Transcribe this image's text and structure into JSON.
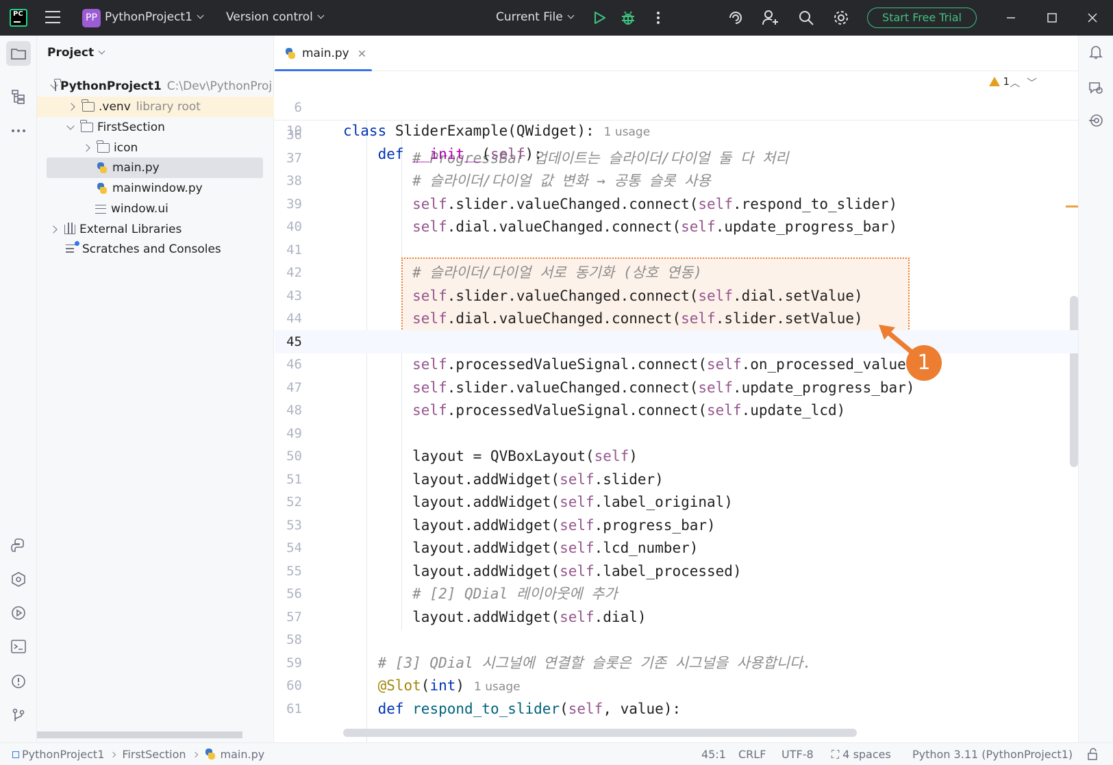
{
  "titlebar": {
    "project_badge": "PP",
    "project_name": "PythonProject1",
    "version_control": "Version control",
    "run_config": "Current File",
    "trial_button": "Start Free Trial",
    "app_logo": "PC"
  },
  "project_panel": {
    "header": "Project",
    "tree": {
      "root_name": "PythonProject1",
      "root_path": "C:\\Dev\\PythonProj",
      "venv_name": ".venv",
      "venv_hint": "library root",
      "folder_first_section": "FirstSection",
      "folder_icon": "icon",
      "file_main": "main.py",
      "file_mainwindow": "mainwindow.py",
      "file_window_ui": "window.ui",
      "external_libraries": "External Libraries",
      "scratches": "Scratches and Consoles"
    }
  },
  "editor": {
    "tab_label": "main.py",
    "warning_count": "1",
    "callout_number": "1",
    "sticky": [
      {
        "ln": "6",
        "code": "class SliderExample(QWidget):",
        "hint": "1 usage"
      },
      {
        "ln": "10",
        "code": "    def __init__(self):"
      }
    ],
    "lines": {
      "l36": {
        "ln": "36",
        "code": ""
      },
      "l37": {
        "ln": "37",
        "code": "        # ProgressBar 업데이트는 슬라이더/다이얼 둘 다 처리"
      },
      "l38": {
        "ln": "38",
        "code": "        # 슬라이더/다이얼 값 변화 → 공통 슬롯 사용"
      },
      "l39": {
        "ln": "39",
        "code": "        self.slider.valueChanged.connect(self.respond_to_slider)"
      },
      "l40": {
        "ln": "40",
        "code": "        self.dial.valueChanged.connect(self.update_progress_bar)"
      },
      "l41": {
        "ln": "41",
        "code": ""
      },
      "l42": {
        "ln": "42",
        "code": "        # 슬라이더/다이얼 서로 동기화 (상호 연동)"
      },
      "l43": {
        "ln": "43",
        "code": "        self.slider.valueChanged.connect(self.dial.setValue)"
      },
      "l44": {
        "ln": "44",
        "code": "        self.dial.valueChanged.connect(self.slider.setValue)"
      },
      "l45": {
        "ln": "45",
        "code": ""
      },
      "l46": {
        "ln": "46",
        "code": "        self.processedValueSignal.connect(self.on_processed_value)"
      },
      "l47": {
        "ln": "47",
        "code": "        self.slider.valueChanged.connect(self.update_progress_bar)"
      },
      "l48": {
        "ln": "48",
        "code": "        self.processedValueSignal.connect(self.update_lcd)"
      },
      "l49": {
        "ln": "49",
        "code": ""
      },
      "l50": {
        "ln": "50",
        "code": "        layout = QVBoxLayout(self)"
      },
      "l51": {
        "ln": "51",
        "code": "        layout.addWidget(self.slider)"
      },
      "l52": {
        "ln": "52",
        "code": "        layout.addWidget(self.label_original)"
      },
      "l53": {
        "ln": "53",
        "code": "        layout.addWidget(self.progress_bar)"
      },
      "l54": {
        "ln": "54",
        "code": "        layout.addWidget(self.lcd_number)"
      },
      "l55": {
        "ln": "55",
        "code": "        layout.addWidget(self.label_processed)"
      },
      "l56": {
        "ln": "56",
        "code": "        # [2] QDial 레이아웃에 추가"
      },
      "l57": {
        "ln": "57",
        "code": "        layout.addWidget(self.dial)"
      },
      "l58": {
        "ln": "58",
        "code": ""
      },
      "l59": {
        "ln": "59",
        "code": "    # [3] QDial 시그널에 연결할 슬롯은 기존 시그널을 사용합니다."
      },
      "l60": {
        "ln": "60",
        "code": "    @Slot(int)",
        "hint": "1 usage"
      },
      "l61": {
        "ln": "61",
        "code": "    def respond_to_slider(self, value):"
      }
    }
  },
  "statusbar": {
    "crumb_project": "PythonProject1",
    "crumb_folder": "FirstSection",
    "crumb_file": "main.py",
    "position": "45:1",
    "line_ending": "CRLF",
    "encoding": "UTF-8",
    "indent": "4 spaces",
    "interpreter": "Python 3.11 (PythonProject1)"
  },
  "colors": {
    "accent": "#3574f0",
    "trial_green": "#3ec47f",
    "callout_orange": "#ed7d31",
    "keyword": "#0033b3",
    "self": "#94558d",
    "comment": "#8c8c8c"
  }
}
